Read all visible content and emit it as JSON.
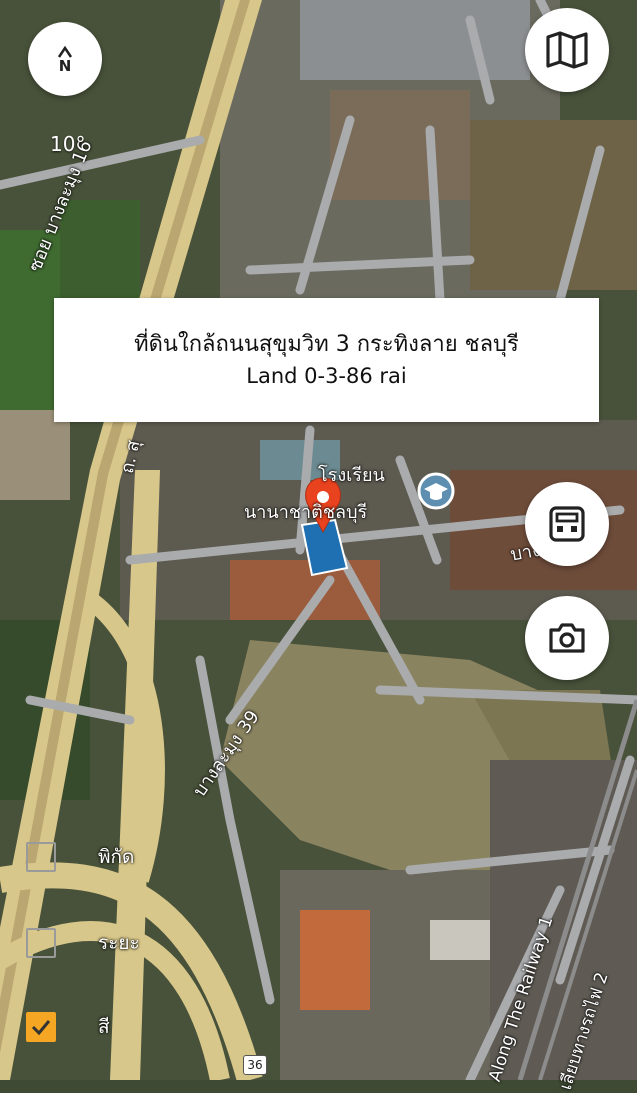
{
  "compass": {
    "icon": "compass-icon",
    "label": "N"
  },
  "tilt": {
    "text": "10°"
  },
  "buttons": [
    {
      "name": "map-type-button",
      "icon": "map-icon"
    },
    {
      "name": "calculator-button",
      "icon": "calculator-icon"
    },
    {
      "name": "camera-button",
      "icon": "camera-icon"
    }
  ],
  "info_card": {
    "title": "ที่ดินใกล้ถนนสุขุมวิท 3 กระทิงลาย ชลบุรี",
    "subtitle": "Land 0-3-86 rai"
  },
  "map_labels": {
    "soi_16": "ซอย บางละมุง 16",
    "school_line1": "โรงเรียน",
    "school_line2": "นานาชาติชลบุรี",
    "road_partial": "ถ. สุ",
    "soi_39": "บางละมุง 39",
    "soi_east": "บาง",
    "railway_1": "Along The Railway 1",
    "railway_2": "เลียบทางรถไฟ 2",
    "route_number": "36"
  },
  "layers": [
    {
      "label": "พิกัด",
      "checked": false
    },
    {
      "label": "ระยะ",
      "checked": false
    },
    {
      "label": "สี",
      "checked": true
    }
  ],
  "colors": {
    "pin": "#e8421f",
    "parcel": "#1f6fb3",
    "checkbox_checked": "#f5a623",
    "highway": "#e8d79b"
  }
}
